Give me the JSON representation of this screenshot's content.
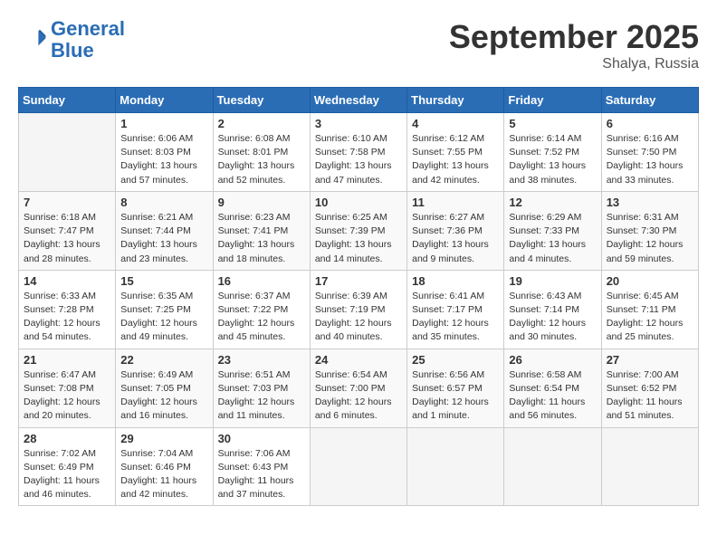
{
  "logo": {
    "line1": "General",
    "line2": "Blue"
  },
  "title": "September 2025",
  "subtitle": "Shalya, Russia",
  "headers": [
    "Sunday",
    "Monday",
    "Tuesday",
    "Wednesday",
    "Thursday",
    "Friday",
    "Saturday"
  ],
  "weeks": [
    [
      {
        "day": "",
        "info": ""
      },
      {
        "day": "1",
        "info": "Sunrise: 6:06 AM\nSunset: 8:03 PM\nDaylight: 13 hours\nand 57 minutes."
      },
      {
        "day": "2",
        "info": "Sunrise: 6:08 AM\nSunset: 8:01 PM\nDaylight: 13 hours\nand 52 minutes."
      },
      {
        "day": "3",
        "info": "Sunrise: 6:10 AM\nSunset: 7:58 PM\nDaylight: 13 hours\nand 47 minutes."
      },
      {
        "day": "4",
        "info": "Sunrise: 6:12 AM\nSunset: 7:55 PM\nDaylight: 13 hours\nand 42 minutes."
      },
      {
        "day": "5",
        "info": "Sunrise: 6:14 AM\nSunset: 7:52 PM\nDaylight: 13 hours\nand 38 minutes."
      },
      {
        "day": "6",
        "info": "Sunrise: 6:16 AM\nSunset: 7:50 PM\nDaylight: 13 hours\nand 33 minutes."
      }
    ],
    [
      {
        "day": "7",
        "info": "Sunrise: 6:18 AM\nSunset: 7:47 PM\nDaylight: 13 hours\nand 28 minutes."
      },
      {
        "day": "8",
        "info": "Sunrise: 6:21 AM\nSunset: 7:44 PM\nDaylight: 13 hours\nand 23 minutes."
      },
      {
        "day": "9",
        "info": "Sunrise: 6:23 AM\nSunset: 7:41 PM\nDaylight: 13 hours\nand 18 minutes."
      },
      {
        "day": "10",
        "info": "Sunrise: 6:25 AM\nSunset: 7:39 PM\nDaylight: 13 hours\nand 14 minutes."
      },
      {
        "day": "11",
        "info": "Sunrise: 6:27 AM\nSunset: 7:36 PM\nDaylight: 13 hours\nand 9 minutes."
      },
      {
        "day": "12",
        "info": "Sunrise: 6:29 AM\nSunset: 7:33 PM\nDaylight: 13 hours\nand 4 minutes."
      },
      {
        "day": "13",
        "info": "Sunrise: 6:31 AM\nSunset: 7:30 PM\nDaylight: 12 hours\nand 59 minutes."
      }
    ],
    [
      {
        "day": "14",
        "info": "Sunrise: 6:33 AM\nSunset: 7:28 PM\nDaylight: 12 hours\nand 54 minutes."
      },
      {
        "day": "15",
        "info": "Sunrise: 6:35 AM\nSunset: 7:25 PM\nDaylight: 12 hours\nand 49 minutes."
      },
      {
        "day": "16",
        "info": "Sunrise: 6:37 AM\nSunset: 7:22 PM\nDaylight: 12 hours\nand 45 minutes."
      },
      {
        "day": "17",
        "info": "Sunrise: 6:39 AM\nSunset: 7:19 PM\nDaylight: 12 hours\nand 40 minutes."
      },
      {
        "day": "18",
        "info": "Sunrise: 6:41 AM\nSunset: 7:17 PM\nDaylight: 12 hours\nand 35 minutes."
      },
      {
        "day": "19",
        "info": "Sunrise: 6:43 AM\nSunset: 7:14 PM\nDaylight: 12 hours\nand 30 minutes."
      },
      {
        "day": "20",
        "info": "Sunrise: 6:45 AM\nSunset: 7:11 PM\nDaylight: 12 hours\nand 25 minutes."
      }
    ],
    [
      {
        "day": "21",
        "info": "Sunrise: 6:47 AM\nSunset: 7:08 PM\nDaylight: 12 hours\nand 20 minutes."
      },
      {
        "day": "22",
        "info": "Sunrise: 6:49 AM\nSunset: 7:05 PM\nDaylight: 12 hours\nand 16 minutes."
      },
      {
        "day": "23",
        "info": "Sunrise: 6:51 AM\nSunset: 7:03 PM\nDaylight: 12 hours\nand 11 minutes."
      },
      {
        "day": "24",
        "info": "Sunrise: 6:54 AM\nSunset: 7:00 PM\nDaylight: 12 hours\nand 6 minutes."
      },
      {
        "day": "25",
        "info": "Sunrise: 6:56 AM\nSunset: 6:57 PM\nDaylight: 12 hours\nand 1 minute."
      },
      {
        "day": "26",
        "info": "Sunrise: 6:58 AM\nSunset: 6:54 PM\nDaylight: 11 hours\nand 56 minutes."
      },
      {
        "day": "27",
        "info": "Sunrise: 7:00 AM\nSunset: 6:52 PM\nDaylight: 11 hours\nand 51 minutes."
      }
    ],
    [
      {
        "day": "28",
        "info": "Sunrise: 7:02 AM\nSunset: 6:49 PM\nDaylight: 11 hours\nand 46 minutes."
      },
      {
        "day": "29",
        "info": "Sunrise: 7:04 AM\nSunset: 6:46 PM\nDaylight: 11 hours\nand 42 minutes."
      },
      {
        "day": "30",
        "info": "Sunrise: 7:06 AM\nSunset: 6:43 PM\nDaylight: 11 hours\nand 37 minutes."
      },
      {
        "day": "",
        "info": ""
      },
      {
        "day": "",
        "info": ""
      },
      {
        "day": "",
        "info": ""
      },
      {
        "day": "",
        "info": ""
      }
    ]
  ]
}
